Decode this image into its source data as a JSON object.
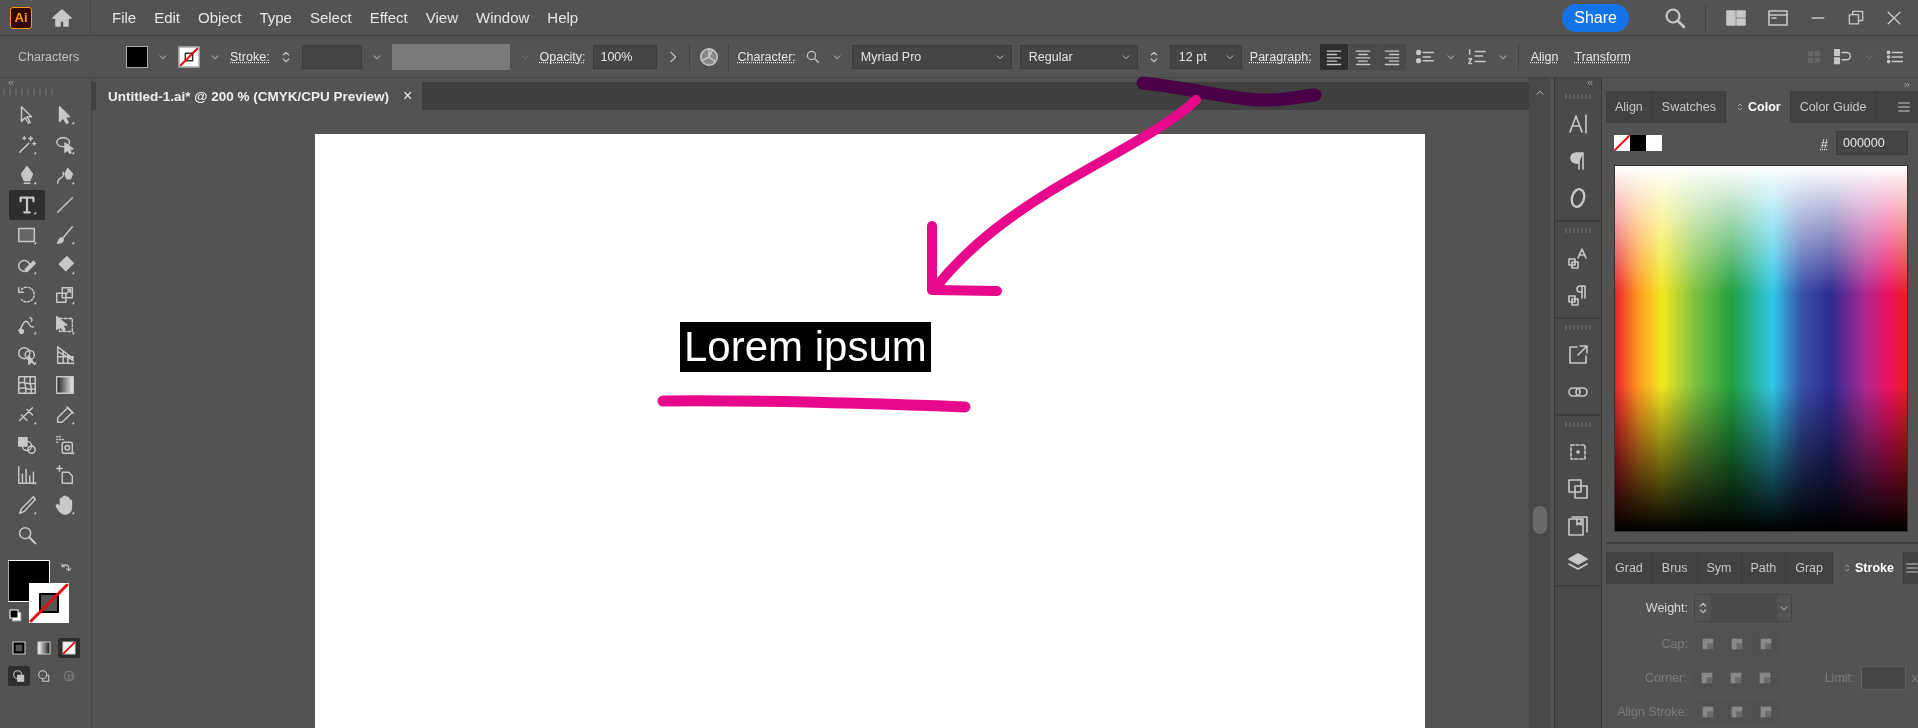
{
  "menu_bar": {
    "app_logo": "Ai",
    "items": [
      "File",
      "Edit",
      "Object",
      "Type",
      "Select",
      "Effect",
      "View",
      "Window",
      "Help"
    ],
    "share": "Share"
  },
  "control_bar": {
    "selection_label": "Characters",
    "stroke_label": "Stroke:",
    "opacity_label": "Opacity:",
    "opacity_value": "100%",
    "character_label": "Character:",
    "font_family": "Myriad Pro",
    "font_style": "Regular",
    "font_size": "12 pt",
    "paragraph_label": "Paragraph:",
    "alignments": [
      {
        "kind": "left",
        "selected": true
      },
      {
        "kind": "center",
        "selected": false
      },
      {
        "kind": "right",
        "selected": false
      }
    ],
    "align_link": "Align",
    "transform_link": "Transform"
  },
  "document_tab": {
    "title": "Untitled-1.ai* @ 200 % (CMYK/CPU Preview)",
    "close": "×"
  },
  "tools": [
    {
      "kind": "selection",
      "selected": false
    },
    {
      "kind": "direct",
      "selected": false
    },
    {
      "kind": "wand",
      "selected": false
    },
    {
      "kind": "lasso",
      "selected": false
    },
    {
      "kind": "pen",
      "selected": false
    },
    {
      "kind": "curvature",
      "selected": false
    },
    {
      "kind": "type",
      "selected": true
    },
    {
      "kind": "line",
      "selected": false
    },
    {
      "kind": "rectangle",
      "selected": false
    },
    {
      "kind": "brush",
      "selected": false
    },
    {
      "kind": "shaper",
      "selected": false
    },
    {
      "kind": "eraser",
      "selected": false
    },
    {
      "kind": "rotate",
      "selected": false
    },
    {
      "kind": "scale",
      "selected": false
    },
    {
      "kind": "width",
      "selected": false
    },
    {
      "kind": "free_transform",
      "selected": false
    },
    {
      "kind": "shape_builder",
      "selected": false
    },
    {
      "kind": "perspective",
      "selected": false
    },
    {
      "kind": "mesh",
      "selected": false
    },
    {
      "kind": "gradient",
      "selected": false
    },
    {
      "kind": "blend",
      "selected": false
    },
    {
      "kind": "eyedropper",
      "selected": false
    },
    {
      "kind": "shapes",
      "selected": false
    },
    {
      "kind": "sprayer",
      "selected": false
    },
    {
      "kind": "graph",
      "selected": false
    },
    {
      "kind": "artboard",
      "selected": false
    },
    {
      "kind": "knife",
      "selected": false
    },
    {
      "kind": "hand",
      "selected": false
    },
    {
      "kind": "zoom",
      "selected": false
    }
  ],
  "color_modes": [
    {
      "kind": "color",
      "selected": false
    },
    {
      "kind": "gradient",
      "selected": false
    },
    {
      "kind": "none",
      "selected": true
    }
  ],
  "draw_modes": [
    {
      "kind": "normal",
      "selected": true,
      "disabled": false
    },
    {
      "kind": "behind",
      "selected": false,
      "disabled": false
    },
    {
      "kind": "inside",
      "selected": false,
      "disabled": true
    }
  ],
  "canvas": {
    "text": "Lorem ipsum",
    "selected": true
  },
  "color_panel": {
    "tabs": [
      {
        "label": "Align",
        "selected": false
      },
      {
        "label": "Swatches",
        "selected": false
      },
      {
        "label": "Color",
        "selected": true
      },
      {
        "label": "Color Guide",
        "selected": false
      }
    ],
    "hex_label": "#",
    "hex_value": "000000"
  },
  "stroke_panel": {
    "tabs": [
      {
        "label": "Grad",
        "selected": false
      },
      {
        "label": "Brus",
        "selected": false
      },
      {
        "label": "Sym",
        "selected": false
      },
      {
        "label": "Path",
        "selected": false
      },
      {
        "label": "Grap",
        "selected": false
      },
      {
        "label": "Stroke",
        "selected": true
      }
    ],
    "rows": [
      {
        "kind": "weight",
        "label": "Weight:",
        "disabled": false
      },
      {
        "kind": "cap",
        "label": "Cap:",
        "disabled": true
      },
      {
        "kind": "corner",
        "label": "Corner:",
        "disabled": true,
        "limit_label": "Limit:",
        "limit_unit": "x"
      },
      {
        "kind": "align",
        "label": "Align Stroke:",
        "disabled": true
      }
    ]
  }
}
